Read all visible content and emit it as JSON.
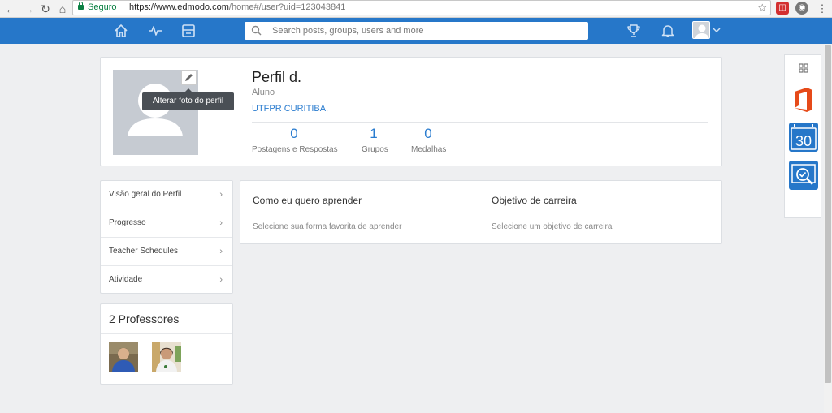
{
  "browser": {
    "secure_label": "Seguro",
    "url_main": "https://www.edmodo.com",
    "url_rest": "/home#/user?uid=123043841"
  },
  "topbar": {
    "search_placeholder": "Search posts, groups, users and more",
    "icons": [
      "home-icon",
      "activity-icon",
      "planner-icon",
      "trophy-icon",
      "bell-icon"
    ],
    "accent": "#2677c9"
  },
  "profile": {
    "name": "Perfil d.",
    "role": "Aluno",
    "school": "UTFPR CURITIBA,",
    "change_photo_tooltip": "Alterar foto do perfil",
    "stats": [
      {
        "value": "0",
        "label": "Postagens e Respostas"
      },
      {
        "value": "1",
        "label": "Grupos"
      },
      {
        "value": "0",
        "label": "Medalhas"
      }
    ]
  },
  "menu": {
    "items": [
      {
        "label": "Visão geral do Perfil"
      },
      {
        "label": "Progresso"
      },
      {
        "label": "Teacher Schedules"
      },
      {
        "label": "Atividade"
      }
    ]
  },
  "teachers": {
    "title": "2 Professores"
  },
  "learning": {
    "how_title": "Como eu quero aprender",
    "how_sub": "Selecione sua forma favorita de aprender",
    "career_title": "Objetivo de carreira",
    "career_sub": "Selecione um objetivo de carreira"
  },
  "side_panel": {
    "calendar_label": "30"
  }
}
